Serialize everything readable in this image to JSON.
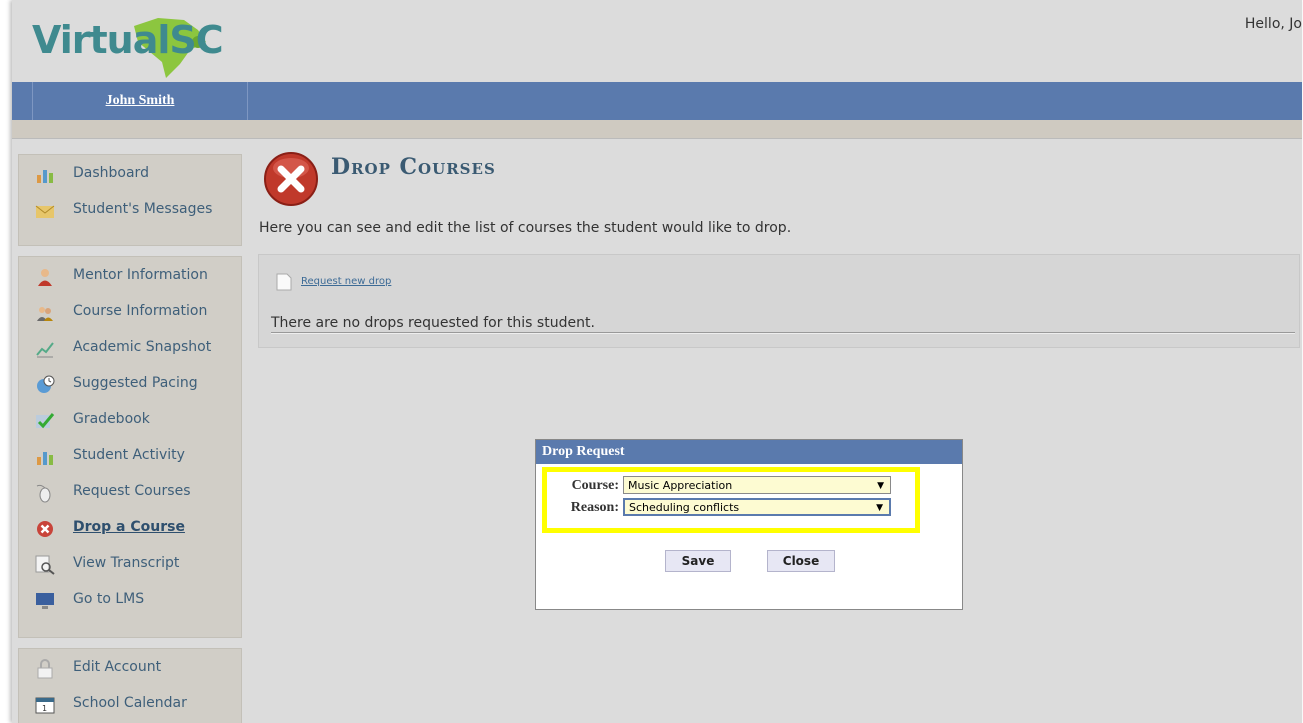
{
  "header": {
    "logo_text": "VirtualSC",
    "greeting": "Hello, Jo"
  },
  "navbar": {
    "user_name": "John Smith"
  },
  "sidebar": {
    "group1": [
      {
        "label": "Dashboard",
        "icon": "chart-icon"
      },
      {
        "label": "Student's Messages",
        "icon": "envelope-icon"
      }
    ],
    "group2": [
      {
        "label": "Mentor Information",
        "icon": "person-icon"
      },
      {
        "label": "Course Information",
        "icon": "people-icon"
      },
      {
        "label": "Academic Snapshot",
        "icon": "graph-icon"
      },
      {
        "label": "Suggested Pacing",
        "icon": "globe-clock-icon"
      },
      {
        "label": "Gradebook",
        "icon": "checkmark-icon"
      },
      {
        "label": "Student Activity",
        "icon": "chart-icon"
      },
      {
        "label": "Request Courses",
        "icon": "mouse-icon"
      },
      {
        "label": "Drop a Course",
        "icon": "drop-icon",
        "active": true
      },
      {
        "label": "View Transcript",
        "icon": "magnifier-icon"
      },
      {
        "label": "Go to LMS",
        "icon": "monitor-icon"
      }
    ],
    "group3": [
      {
        "label": "Edit Account",
        "icon": "lock-icon"
      },
      {
        "label": "School Calendar",
        "icon": "calendar-icon"
      }
    ]
  },
  "main": {
    "title": "Drop Courses",
    "description": "Here you can see and edit the list of courses the student would like to drop.",
    "request_link": "Request new drop",
    "no_drops": "There are no drops requested for this student."
  },
  "dialog": {
    "title": "Drop Request",
    "course_label": "Course:",
    "course_value": "Music Appreciation",
    "reason_label": "Reason:",
    "reason_value": "Scheduling conflicts",
    "save_label": "Save",
    "close_label": "Close"
  },
  "colors": {
    "nav_blue": "#5a7aad",
    "highlight": "#ffff00",
    "sidebar_bg": "#d1cec7"
  }
}
